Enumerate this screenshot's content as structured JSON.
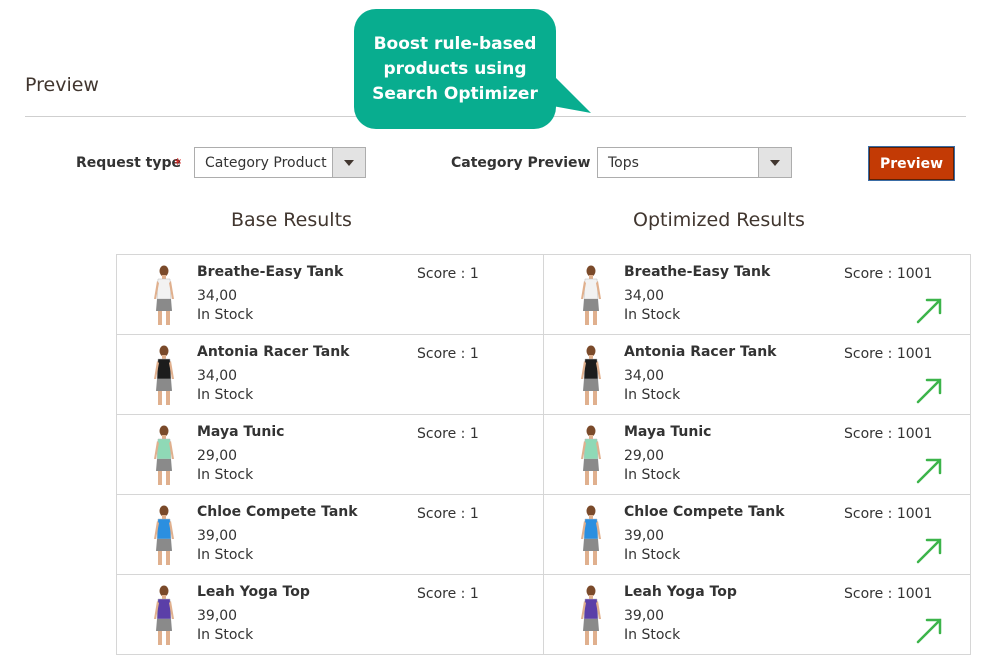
{
  "section_title": "Preview",
  "callout": {
    "line1": "Boost rule-based",
    "line2": "products using",
    "line3": "Search Optimizer"
  },
  "controls": {
    "request_type_label": "Request type",
    "required_mark": "*",
    "request_type_value": "Category Product",
    "category_preview_label": "Category Preview",
    "category_preview_value": "Tops",
    "preview_button": "Preview"
  },
  "base": {
    "title": "Base Results",
    "items": [
      {
        "name": "Breathe-Easy Tank",
        "price": "34,00",
        "stock": "In Stock",
        "score": "Score : 1"
      },
      {
        "name": "Antonia Racer Tank",
        "price": "34,00",
        "stock": "In Stock",
        "score": "Score : 1"
      },
      {
        "name": "Maya Tunic",
        "price": "29,00",
        "stock": "In Stock",
        "score": "Score : 1"
      },
      {
        "name": "Chloe Compete Tank",
        "price": "39,00",
        "stock": "In Stock",
        "score": "Score : 1"
      },
      {
        "name": "Leah Yoga Top",
        "price": "39,00",
        "stock": "In Stock",
        "score": "Score : 1"
      }
    ]
  },
  "optimized": {
    "title": "Optimized Results",
    "items": [
      {
        "name": "Breathe-Easy Tank",
        "price": "34,00",
        "stock": "In Stock",
        "score": "Score : 1001"
      },
      {
        "name": "Antonia Racer Tank",
        "price": "34,00",
        "stock": "In Stock",
        "score": "Score : 1001"
      },
      {
        "name": "Maya Tunic",
        "price": "29,00",
        "stock": "In Stock",
        "score": "Score : 1001"
      },
      {
        "name": "Chloe Compete Tank",
        "price": "39,00",
        "stock": "In Stock",
        "score": "Score : 1001"
      },
      {
        "name": "Leah Yoga Top",
        "price": "39,00",
        "stock": "In Stock",
        "score": "Score : 1001"
      }
    ]
  },
  "colors": {
    "callout_bg": "#08ad8f",
    "button_bg": "#c33a05",
    "arrow_green": "#3cb44a",
    "product_colors": [
      "#f2f2f2",
      "#1c1c1c",
      "#8fd9b6",
      "#2b8fe0",
      "#5b3fa8"
    ]
  },
  "icons": {
    "boost": "arrow-up-right-icon",
    "dropdown": "caret-down-icon"
  }
}
